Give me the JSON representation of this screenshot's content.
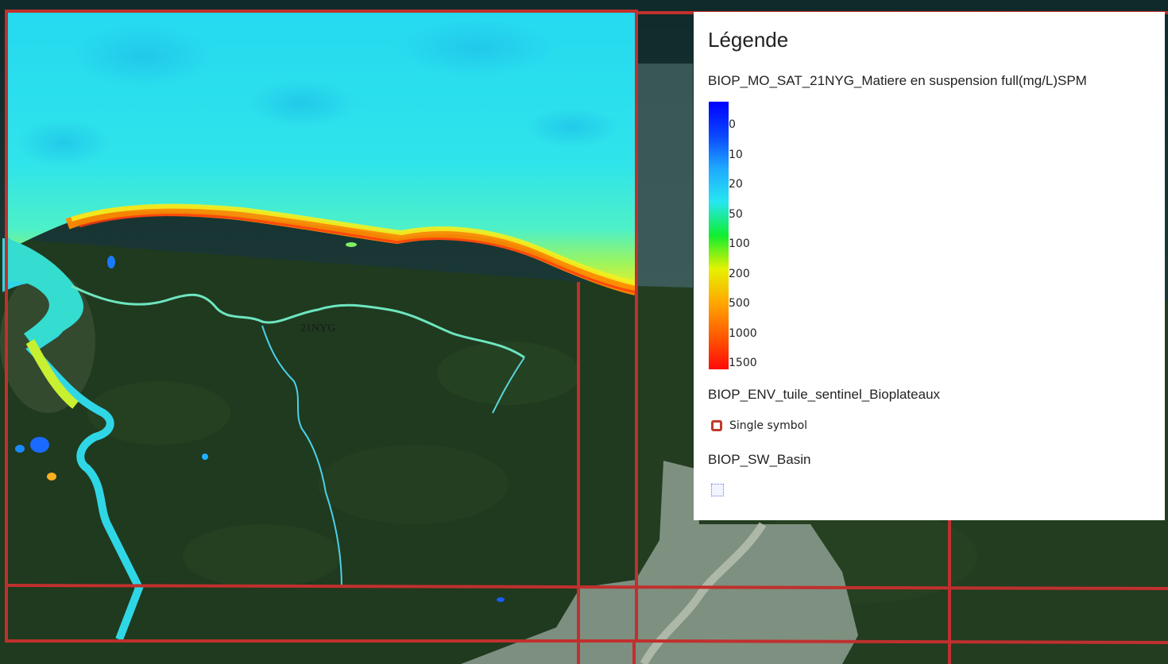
{
  "map": {
    "tile_label": "21NYG",
    "colors": {
      "frame_red": "#c0302e",
      "forest": "#1f3a1e",
      "sea_cyan": "#2fe0ea",
      "coast_orange": "#ff8a00"
    }
  },
  "legend": {
    "title": "Légende",
    "layers": [
      {
        "name": "BIOP_MO_SAT_21NYG_Matiere en suspension full(mg/L)SPM",
        "type": "color-ramp",
        "ramp_labels": [
          "0",
          "10",
          "20",
          "50",
          "100",
          "200",
          "500",
          "1000",
          "1500"
        ],
        "ramp_colors": [
          "#0000ff",
          "#0a46ff",
          "#1eaaff",
          "#28e6f0",
          "#10ee30",
          "#e6f200",
          "#ffa800",
          "#ff5a00",
          "#ff0a0a"
        ]
      },
      {
        "name": "BIOP_ENV_tuile_sentinel_Bioplateaux",
        "type": "single-symbol",
        "symbol_label": "Single symbol",
        "symbol_icon": "red-square-outline-icon"
      },
      {
        "name": "BIOP_SW_Basin",
        "type": "polygon",
        "symbol_icon": "dotted-square-icon"
      }
    ]
  }
}
